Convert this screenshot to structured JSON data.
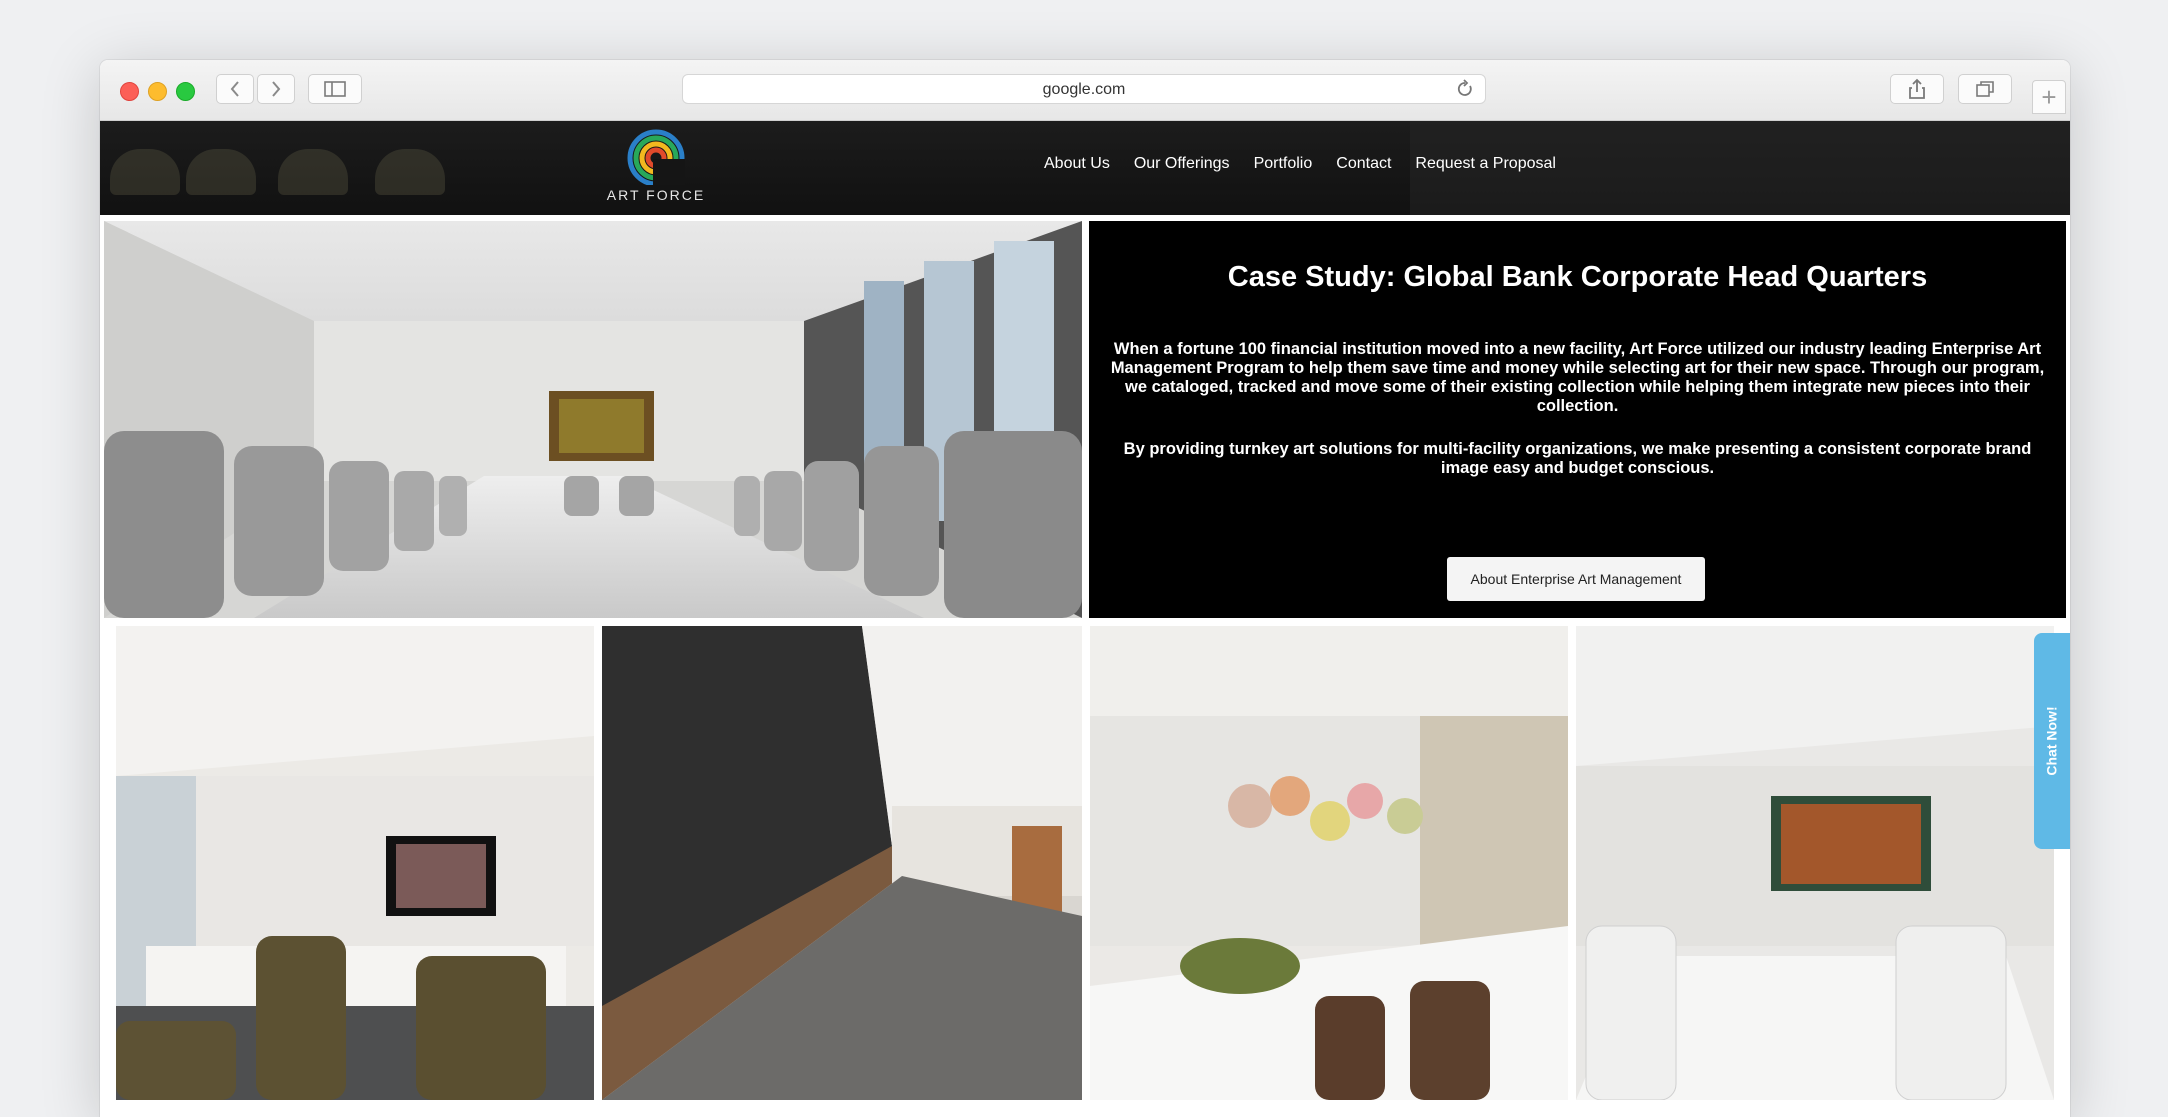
{
  "browser": {
    "url": "google.com"
  },
  "site": {
    "brand": "ART FORCE",
    "nav": [
      "About Us",
      "Our Offerings",
      "Portfolio",
      "Contact",
      "Request a Proposal"
    ]
  },
  "case_study": {
    "title": "Case Study: Global Bank Corporate Head Quarters",
    "paragraph1": "When a fortune 100 financial institution moved into a new facility, Art Force utilized our industry leading Enterprise Art Management Program to help them save time and money while selecting art for their new space. Through our program, we cataloged, tracked and move some of their existing collection while helping them integrate new pieces into their collection.",
    "paragraph2": "By providing turnkey art solutions for multi-facility organizations, we make presenting a consistent corporate brand image easy and budget conscious.",
    "button_label": "About Enterprise Art Management"
  },
  "chat": {
    "label": "Chat Now!"
  },
  "colors": {
    "header_bg": "#111111",
    "panel_bg": "#000000",
    "chat_tab": "#5fb9e6",
    "logo_ring_1": "#2a7fc8",
    "logo_ring_2": "#28a85a",
    "logo_ring_3": "#f2b81f",
    "logo_ring_4": "#e14a2b"
  }
}
